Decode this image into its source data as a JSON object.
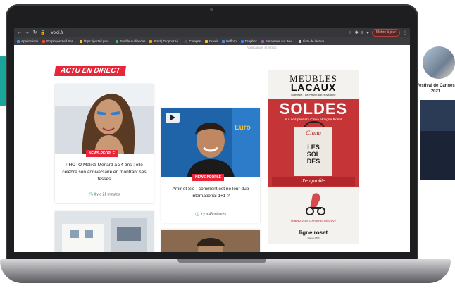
{
  "background": {
    "right_caption": "Festival de Cannes 2021"
  },
  "browser": {
    "url": "voici.fr",
    "update_button": "Mettre à jour",
    "bookmarks": [
      {
        "label": "Applications",
        "color": "#4a90d9"
      },
      {
        "label": "Employés Self Ser...",
        "color": "#e94b3c"
      },
      {
        "label": "https://portail.proc...",
        "color": "#f5c242"
      },
      {
        "label": "Enable Audiences",
        "color": "#3cb371"
      },
      {
        "label": "Start | Dropout Vi...",
        "color": "#f5a623"
      },
      {
        "label": "Comptis",
        "color": "#555555"
      },
      {
        "label": "Ouvrir",
        "color": "#f5c242"
      },
      {
        "label": "Hefloro",
        "color": "#4a90d9"
      },
      {
        "label": "Dropbox",
        "color": "#3b82f6"
      },
      {
        "label": "Bienvenue sur Jou...",
        "color": "#9b59b6"
      },
      {
        "label": "Liste de lecture",
        "color": "#cccccc"
      }
    ],
    "extensions_ghost": "Applications et effacs"
  },
  "section": {
    "title": "ACTU EN DIRECT"
  },
  "articles": [
    {
      "badge": "NEWS-PEOPLE",
      "title": "PHOTO Malika Ménard a 34 ans : elle célèbre son anniversaire en montrant ses fesses",
      "time": "Il y a 21 minutes"
    },
    {
      "badge": "NEWS-PEOPLE",
      "title": "Amir et Sio : comment est né leur duo international 1+1 ?",
      "time": "Il y a 48 minutes"
    }
  ],
  "ad": {
    "brand_line1": "MEUBLES",
    "brand_line2": "LACAUX",
    "location": "Marseille - La Penne-sur-Huveaune",
    "headline": "SOLDES",
    "subline": "sur nos produits Cinna et Ligne Roset",
    "bag_brand": "Cinna",
    "bag_text": [
      "LES",
      "SOL",
      "DES"
    ],
    "cta": "J'en profite",
    "rdv": "RENDEZ-VOUS D'AFFAIRES RÉSERVÉ",
    "brand2": "ligne roset",
    "brand2_sub": "Depuis 1860"
  },
  "colors": {
    "accent": "#e6273a",
    "ad_red": "#c53436",
    "teal": "#2eb39a"
  }
}
